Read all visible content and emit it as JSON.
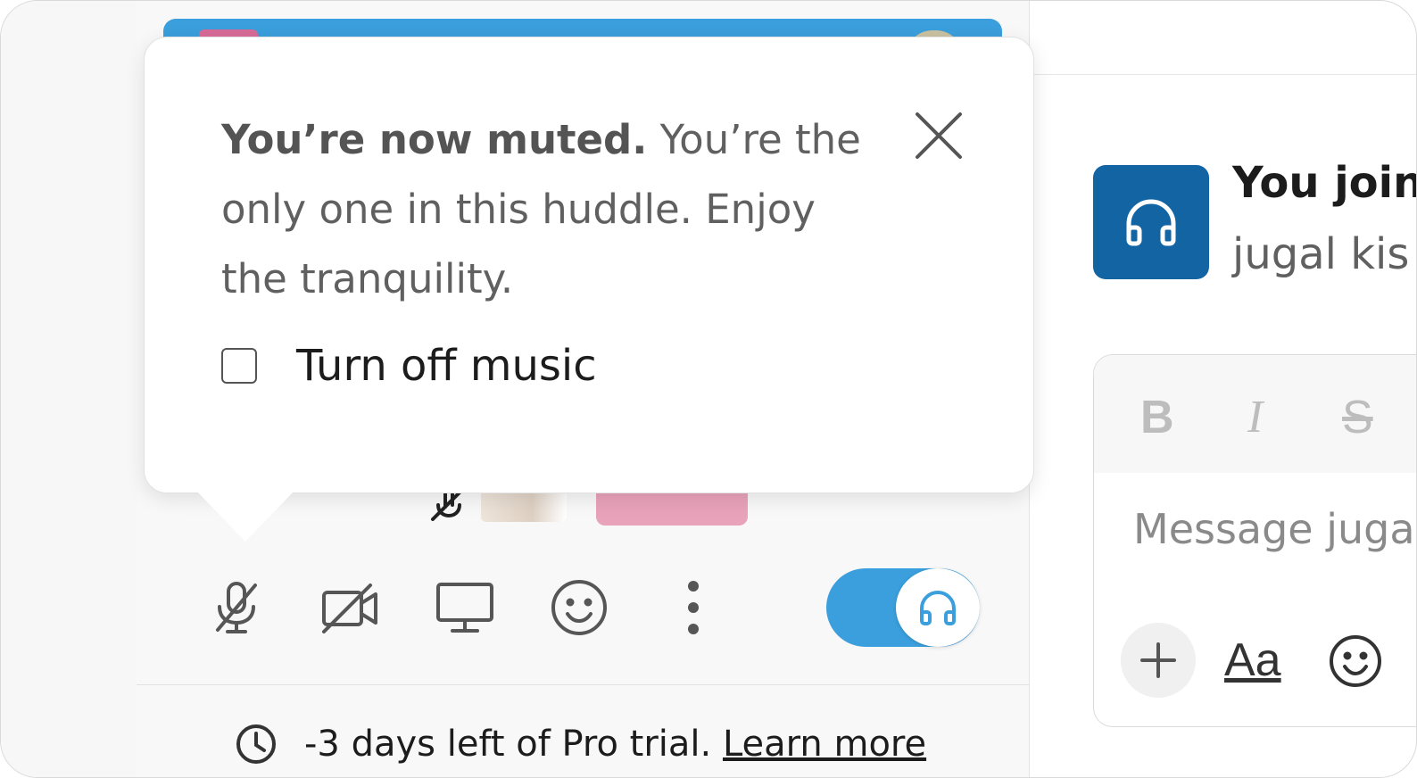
{
  "popover": {
    "title_bold": "You’re now muted.",
    "message": " You’re the only one in this huddle. Enjoy the tranquility.",
    "checkbox_label": "Turn off music",
    "checkbox_checked": false
  },
  "controls": {
    "icons": [
      "mic-muted-icon",
      "video-off-icon",
      "screen-share-icon",
      "emoji-icon",
      "more-vertical-icon",
      "headphones-icon"
    ],
    "music_toggle_on": true
  },
  "trial": {
    "text": "-3 days left of Pro trial.",
    "link": "Learn more"
  },
  "channel": {
    "joined_title": "You join",
    "joined_sub": "jugal kis"
  },
  "composer": {
    "bold": "B",
    "italic": "I",
    "strike": "S",
    "placeholder": "Message juga",
    "format_text": "Aa"
  },
  "colors": {
    "accent_blue": "#3a9fdc",
    "huddle_icon_bg": "#1264a3",
    "thumb_pink": "#e8a2b9"
  }
}
